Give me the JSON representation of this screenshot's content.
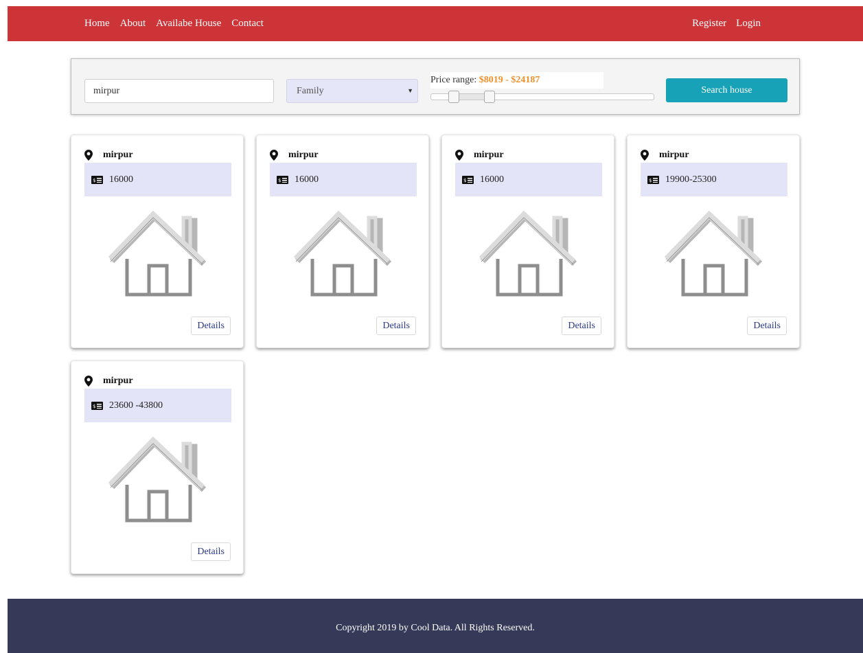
{
  "nav": {
    "left": [
      "Home",
      "About",
      "Availabe House",
      "Contact"
    ],
    "right": [
      "Register",
      "Login"
    ]
  },
  "search": {
    "location_value": "mirpur",
    "type_selected": "Family",
    "price_label": "Price range:",
    "price_value": "$8019 - $24187",
    "slider": {
      "low_fraction": 0.08,
      "high_fraction": 0.24
    },
    "button_label": "Search house"
  },
  "cards": [
    {
      "location": "mirpur",
      "price": "16000",
      "details_label": "Details"
    },
    {
      "location": "mirpur",
      "price": "16000",
      "details_label": "Details"
    },
    {
      "location": "mirpur",
      "price": "16000",
      "details_label": "Details"
    },
    {
      "location": "mirpur",
      "price": "19900-25300",
      "details_label": "Details"
    },
    {
      "location": "mirpur",
      "price": "23600 -43800",
      "details_label": "Details"
    }
  ],
  "footer": {
    "text": "Copyright 2019 by Cool Data. All Rights Reserved."
  },
  "colors": {
    "navbar": "#cc3438",
    "search_button": "#17a2b8",
    "price_highlight": "#f0912b",
    "price_box": "#e3e4f8",
    "footer": "#353a58"
  },
  "icons": [
    "map-marker-icon",
    "money-bill-icon",
    "house-icon",
    "caret-down-icon"
  ]
}
